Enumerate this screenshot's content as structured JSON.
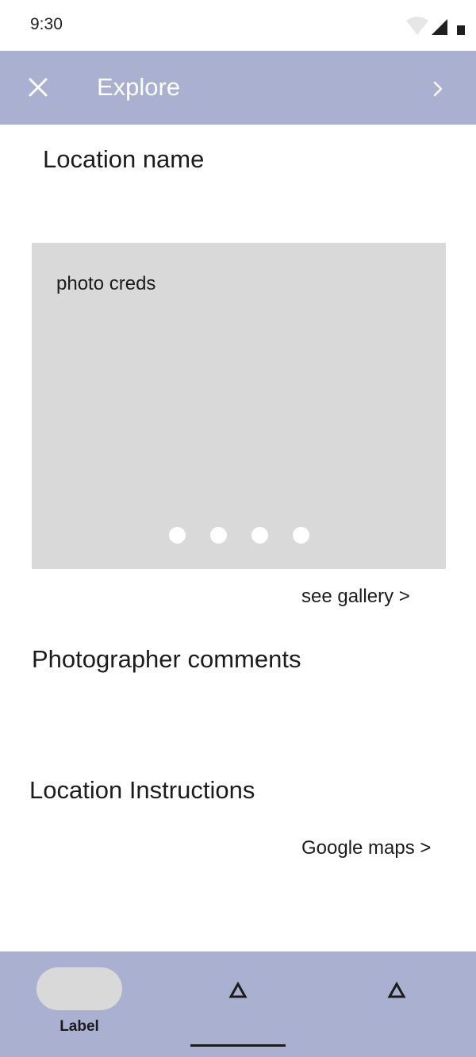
{
  "status_bar": {
    "time": "9:30",
    "icons": [
      "wifi-icon",
      "signal-icon",
      "battery-icon"
    ]
  },
  "app_bar": {
    "title": "Explore",
    "left_icon": "close-icon",
    "right_icon": "chevron-right-icon",
    "background": "#aab0cf"
  },
  "content": {
    "location_name": "Location name",
    "photo": {
      "credit": "photo creds",
      "page_count": 4,
      "placeholder_color": "#d9d9d9"
    },
    "see_gallery": "see gallery >",
    "photographer_comments": "Photographer comments",
    "location_instructions": "Location Instructions",
    "google_maps": "Google maps >"
  },
  "bottom_nav": {
    "items": [
      {
        "label": "Label",
        "icon": "pill-icon"
      },
      {
        "label": "",
        "icon": "triangle-icon"
      },
      {
        "label": "",
        "icon": "triangle-icon"
      }
    ],
    "active_indicator_item": 1,
    "background": "#aab0cf"
  }
}
